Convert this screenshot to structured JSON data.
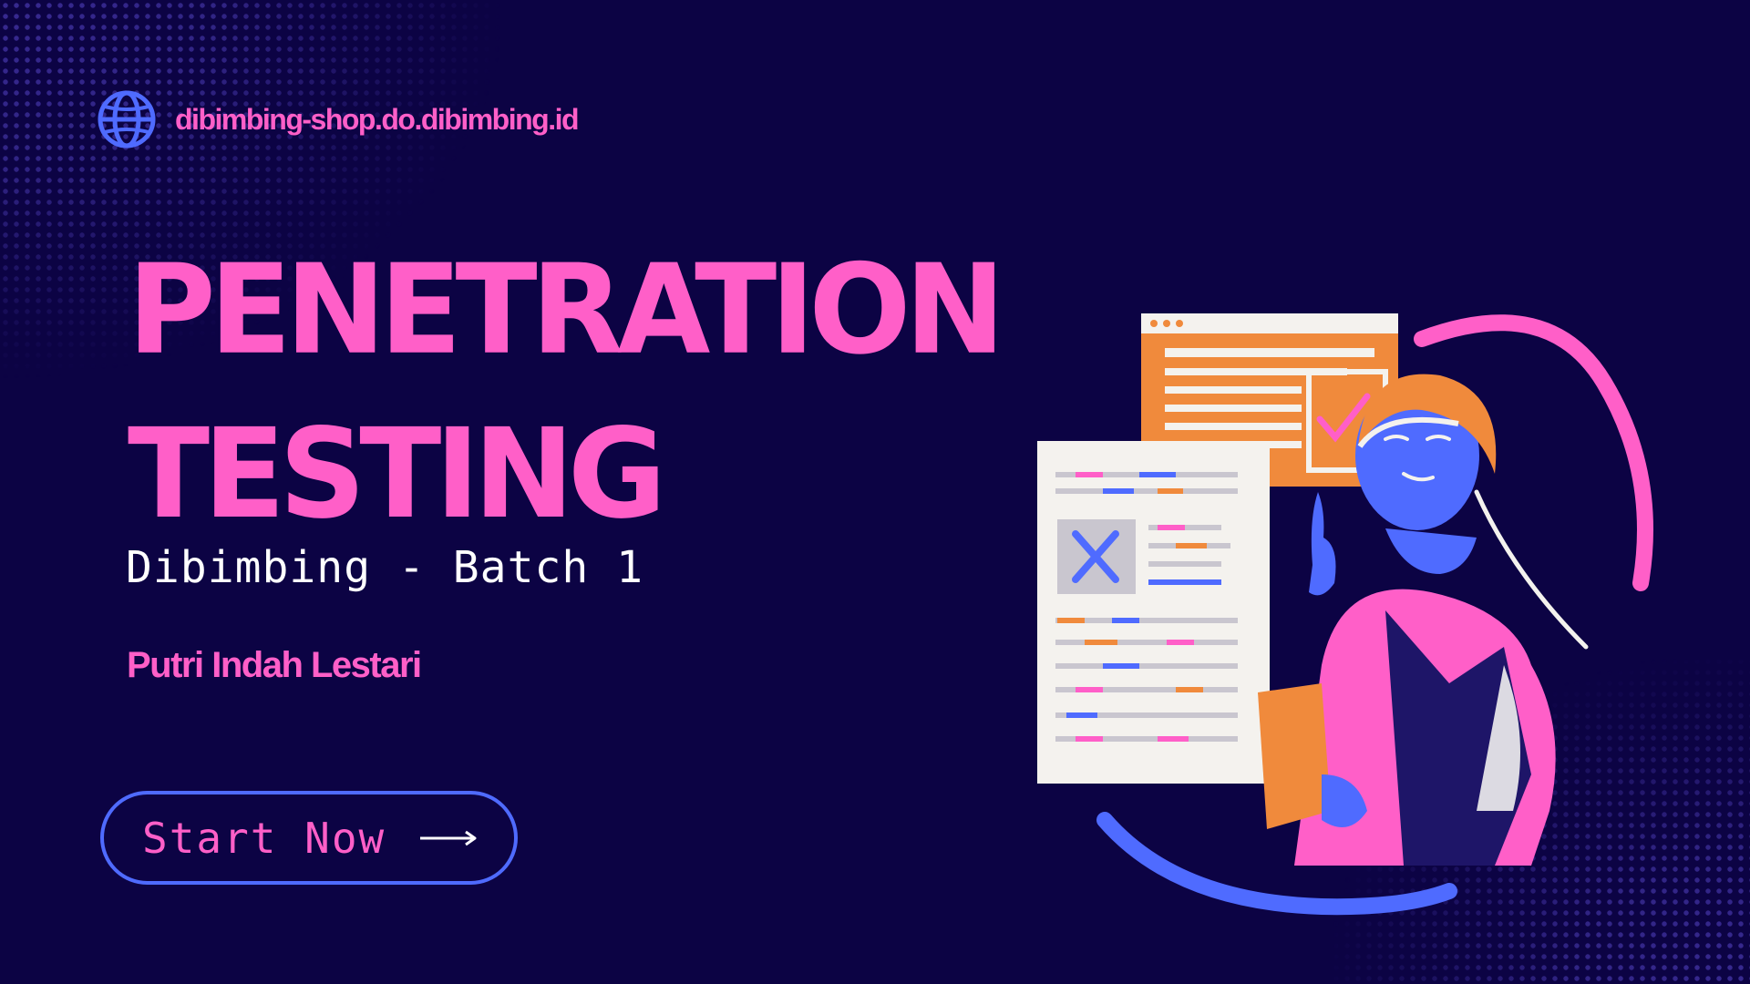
{
  "header": {
    "url": "dibimbing-shop.do.dibimbing.id",
    "icon": "globe-icon"
  },
  "hero": {
    "title_line1": "PENETRATION",
    "title_line2": "TESTING",
    "subtitle": "Dibimbing - Batch 1",
    "author": "Putri Indah Lestari"
  },
  "cta": {
    "label": "Start Now",
    "icon": "arrow-right-icon"
  },
  "illustration": {
    "icon": "woman-with-documents-illustration",
    "check_icon": "check-icon",
    "cross_icon": "x-icon"
  },
  "colors": {
    "background": "#0c0344",
    "accent_pink": "#ff5fc8",
    "accent_blue": "#4f6bff",
    "accent_orange": "#f08a3c",
    "text_white": "#ffffff"
  }
}
